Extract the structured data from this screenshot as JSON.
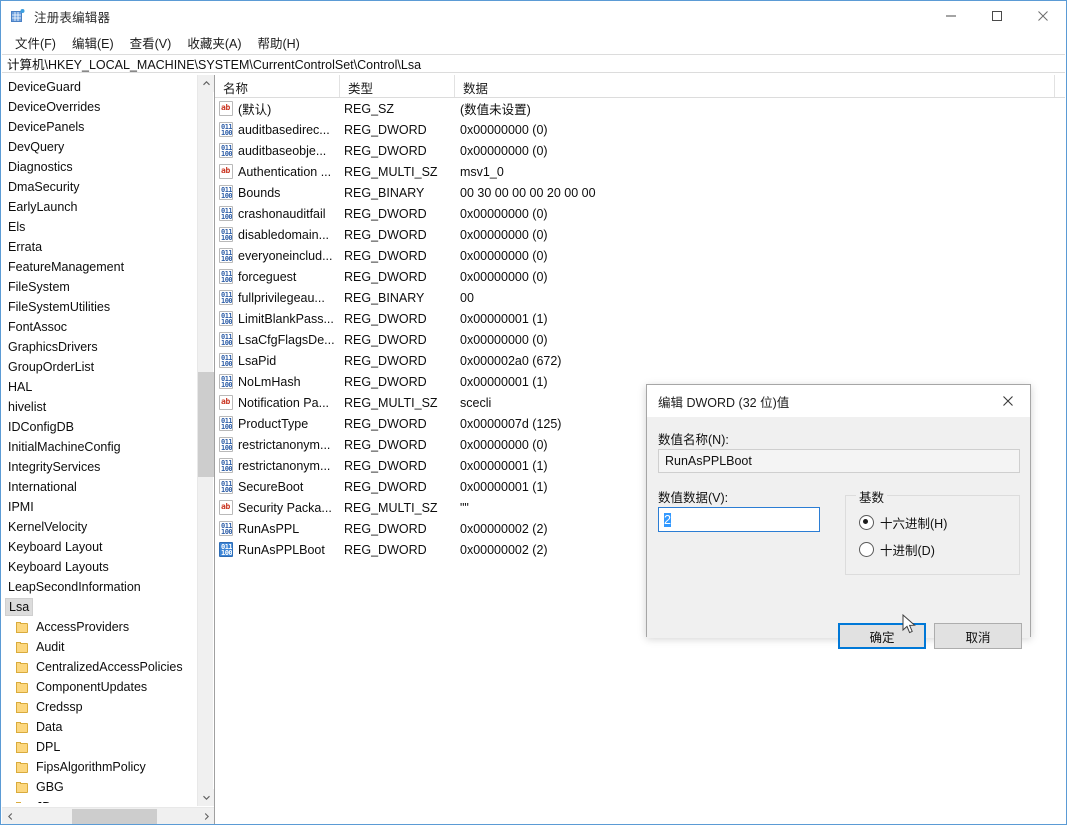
{
  "window": {
    "title": "注册表编辑器",
    "icon": "registry-editor-icon",
    "minimize_label": "–",
    "maximize_label": "□",
    "close_label": "✕",
    "accent": "#0078d7",
    "border_color": "#5b9bd5"
  },
  "menu": {
    "items": [
      {
        "label": "文件(F)"
      },
      {
        "label": "编辑(E)"
      },
      {
        "label": "查看(V)"
      },
      {
        "label": "收藏夹(A)"
      },
      {
        "label": "帮助(H)"
      }
    ]
  },
  "address": {
    "path": "计算机\\HKEY_LOCAL_MACHINE\\SYSTEM\\CurrentControlSet\\Control\\Lsa"
  },
  "tree": {
    "selected": "Lsa",
    "items": [
      {
        "label": "DeviceGuard",
        "indent": 0,
        "folder": false,
        "selected": false
      },
      {
        "label": "DeviceOverrides",
        "indent": 0,
        "folder": false,
        "selected": false
      },
      {
        "label": "DevicePanels",
        "indent": 0,
        "folder": false,
        "selected": false
      },
      {
        "label": "DevQuery",
        "indent": 0,
        "folder": false,
        "selected": false
      },
      {
        "label": "Diagnostics",
        "indent": 0,
        "folder": false,
        "selected": false
      },
      {
        "label": "DmaSecurity",
        "indent": 0,
        "folder": false,
        "selected": false
      },
      {
        "label": "EarlyLaunch",
        "indent": 0,
        "folder": false,
        "selected": false
      },
      {
        "label": "Els",
        "indent": 0,
        "folder": false,
        "selected": false
      },
      {
        "label": "Errata",
        "indent": 0,
        "folder": false,
        "selected": false
      },
      {
        "label": "FeatureManagement",
        "indent": 0,
        "folder": false,
        "selected": false
      },
      {
        "label": "FileSystem",
        "indent": 0,
        "folder": false,
        "selected": false
      },
      {
        "label": "FileSystemUtilities",
        "indent": 0,
        "folder": false,
        "selected": false
      },
      {
        "label": "FontAssoc",
        "indent": 0,
        "folder": false,
        "selected": false
      },
      {
        "label": "GraphicsDrivers",
        "indent": 0,
        "folder": false,
        "selected": false
      },
      {
        "label": "GroupOrderList",
        "indent": 0,
        "folder": false,
        "selected": false
      },
      {
        "label": "HAL",
        "indent": 0,
        "folder": false,
        "selected": false
      },
      {
        "label": "hivelist",
        "indent": 0,
        "folder": false,
        "selected": false
      },
      {
        "label": "IDConfigDB",
        "indent": 0,
        "folder": false,
        "selected": false
      },
      {
        "label": "InitialMachineConfig",
        "indent": 0,
        "folder": false,
        "selected": false
      },
      {
        "label": "IntegrityServices",
        "indent": 0,
        "folder": false,
        "selected": false
      },
      {
        "label": "International",
        "indent": 0,
        "folder": false,
        "selected": false
      },
      {
        "label": "IPMI",
        "indent": 0,
        "folder": false,
        "selected": false
      },
      {
        "label": "KernelVelocity",
        "indent": 0,
        "folder": false,
        "selected": false
      },
      {
        "label": "Keyboard Layout",
        "indent": 0,
        "folder": false,
        "selected": false
      },
      {
        "label": "Keyboard Layouts",
        "indent": 0,
        "folder": false,
        "selected": false
      },
      {
        "label": "LeapSecondInformation",
        "indent": 0,
        "folder": false,
        "selected": false
      },
      {
        "label": "Lsa",
        "indent": 0,
        "folder": false,
        "selected": true
      },
      {
        "label": "AccessProviders",
        "indent": 1,
        "folder": true,
        "selected": false
      },
      {
        "label": "Audit",
        "indent": 1,
        "folder": true,
        "selected": false
      },
      {
        "label": "CentralizedAccessPolicies",
        "indent": 1,
        "folder": true,
        "selected": false
      },
      {
        "label": "ComponentUpdates",
        "indent": 1,
        "folder": true,
        "selected": false
      },
      {
        "label": "Credssp",
        "indent": 1,
        "folder": true,
        "selected": false
      },
      {
        "label": "Data",
        "indent": 1,
        "folder": true,
        "selected": false
      },
      {
        "label": "DPL",
        "indent": 1,
        "folder": true,
        "selected": false
      },
      {
        "label": "FipsAlgorithmPolicy",
        "indent": 1,
        "folder": true,
        "selected": false
      },
      {
        "label": "GBG",
        "indent": 1,
        "folder": true,
        "selected": false
      },
      {
        "label": "JD",
        "indent": 1,
        "folder": true,
        "selected": false
      }
    ]
  },
  "value_list": {
    "columns": [
      {
        "label": "名称"
      },
      {
        "label": "类型"
      },
      {
        "label": "数据"
      }
    ],
    "rows": [
      {
        "name": "(默认)",
        "type": "REG_SZ",
        "data": "(数值未设置)",
        "icon": "string-value-icon",
        "selected": false
      },
      {
        "name": "auditbasedirec...",
        "type": "REG_DWORD",
        "data": "0x00000000 (0)",
        "icon": "binary-value-icon",
        "selected": false
      },
      {
        "name": "auditbaseobje...",
        "type": "REG_DWORD",
        "data": "0x00000000 (0)",
        "icon": "binary-value-icon",
        "selected": false
      },
      {
        "name": "Authentication ...",
        "type": "REG_MULTI_SZ",
        "data": "msv1_0",
        "icon": "string-value-icon",
        "selected": false
      },
      {
        "name": "Bounds",
        "type": "REG_BINARY",
        "data": "00 30 00 00 00 20 00 00",
        "icon": "binary-value-icon",
        "selected": false
      },
      {
        "name": "crashonauditfail",
        "type": "REG_DWORD",
        "data": "0x00000000 (0)",
        "icon": "binary-value-icon",
        "selected": false
      },
      {
        "name": "disabledomain...",
        "type": "REG_DWORD",
        "data": "0x00000000 (0)",
        "icon": "binary-value-icon",
        "selected": false
      },
      {
        "name": "everyoneinclud...",
        "type": "REG_DWORD",
        "data": "0x00000000 (0)",
        "icon": "binary-value-icon",
        "selected": false
      },
      {
        "name": "forceguest",
        "type": "REG_DWORD",
        "data": "0x00000000 (0)",
        "icon": "binary-value-icon",
        "selected": false
      },
      {
        "name": "fullprivilegeau...",
        "type": "REG_BINARY",
        "data": "00",
        "icon": "binary-value-icon",
        "selected": false
      },
      {
        "name": "LimitBlankPass...",
        "type": "REG_DWORD",
        "data": "0x00000001 (1)",
        "icon": "binary-value-icon",
        "selected": false
      },
      {
        "name": "LsaCfgFlagsDe...",
        "type": "REG_DWORD",
        "data": "0x00000000 (0)",
        "icon": "binary-value-icon",
        "selected": false
      },
      {
        "name": "LsaPid",
        "type": "REG_DWORD",
        "data": "0x000002a0 (672)",
        "icon": "binary-value-icon",
        "selected": false
      },
      {
        "name": "NoLmHash",
        "type": "REG_DWORD",
        "data": "0x00000001 (1)",
        "icon": "binary-value-icon",
        "selected": false
      },
      {
        "name": "Notification Pa...",
        "type": "REG_MULTI_SZ",
        "data": "scecli",
        "icon": "string-value-icon",
        "selected": false
      },
      {
        "name": "ProductType",
        "type": "REG_DWORD",
        "data": "0x0000007d (125)",
        "icon": "binary-value-icon",
        "selected": false
      },
      {
        "name": "restrictanonym...",
        "type": "REG_DWORD",
        "data": "0x00000000 (0)",
        "icon": "binary-value-icon",
        "selected": false
      },
      {
        "name": "restrictanonym...",
        "type": "REG_DWORD",
        "data": "0x00000001 (1)",
        "icon": "binary-value-icon",
        "selected": false
      },
      {
        "name": "SecureBoot",
        "type": "REG_DWORD",
        "data": "0x00000001 (1)",
        "icon": "binary-value-icon",
        "selected": false
      },
      {
        "name": "Security Packa...",
        "type": "REG_MULTI_SZ",
        "data": "\"\"",
        "icon": "string-value-icon",
        "selected": false
      },
      {
        "name": "RunAsPPL",
        "type": "REG_DWORD",
        "data": "0x00000002 (2)",
        "icon": "binary-value-icon",
        "selected": false
      },
      {
        "name": "RunAsPPLBoot",
        "type": "REG_DWORD",
        "data": "0x00000002 (2)",
        "icon": "binary-value-icon",
        "selected": true
      }
    ]
  },
  "dialog": {
    "title": "编辑 DWORD (32 位)值",
    "close_label": "✕",
    "name_label": "数值名称(N):",
    "name_value": "RunAsPPLBoot",
    "data_label": "数值数据(V):",
    "data_value": "2",
    "base_legend": "基数",
    "radio_hex": "十六进制(H)",
    "radio_dec": "十进制(D)",
    "radio_selected": "hex",
    "ok_label": "确定",
    "cancel_label": "取消"
  }
}
